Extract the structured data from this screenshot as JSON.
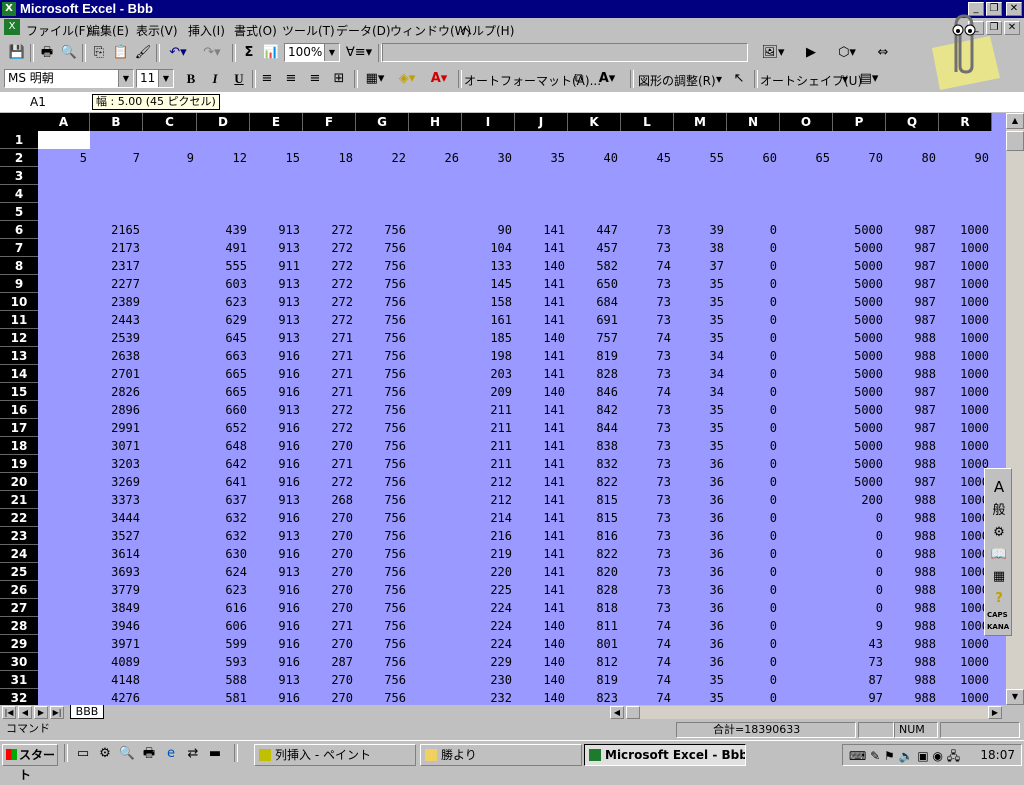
{
  "title_bar": {
    "title": "Microsoft Excel - Bbb"
  },
  "menu": [
    "ファイル(F)",
    "編集(E)",
    "表示(V)",
    "挿入(I)",
    "書式(O)",
    "ツール(T)",
    "データ(D)",
    "ウィンドウ(W)",
    "ヘルプ(H)"
  ],
  "toolbar": {
    "zoom": "100%",
    "sum_symbol": "Σ"
  },
  "format_toolbar": {
    "font": "MS 明朝",
    "size": "11",
    "bold": "B",
    "italic": "I",
    "underline": "U",
    "autoformat": "オートフォーマット(A)...",
    "draw_adjust": "図形の調整(R)",
    "autoshape": "オートシェイプ(U)"
  },
  "formula_bar": {
    "name_box": "A1",
    "tooltip": "幅 : 5.00 (45 ピクセル)"
  },
  "columns": [
    "A",
    "B",
    "C",
    "D",
    "E",
    "F",
    "G",
    "H",
    "I",
    "J",
    "K",
    "L",
    "M",
    "N",
    "O",
    "P",
    "Q",
    "R"
  ],
  "rows": [
    {
      "n": "1",
      "v": [
        "",
        "",
        "",
        "",
        "",
        "",
        "",
        "",
        "",
        "",
        "",
        "",
        "",
        "",
        "",
        "",
        "",
        ""
      ]
    },
    {
      "n": "2",
      "v": [
        "5",
        "7",
        "9",
        "12",
        "15",
        "18",
        "22",
        "26",
        "30",
        "35",
        "40",
        "45",
        "55",
        "60",
        "65",
        "70",
        "80",
        "90"
      ]
    },
    {
      "n": "3",
      "v": [
        "",
        "",
        "",
        "",
        "",
        "",
        "",
        "",
        "",
        "",
        "",
        "",
        "",
        "",
        "",
        "",
        "",
        ""
      ]
    },
    {
      "n": "4",
      "v": [
        "",
        "",
        "",
        "",
        "",
        "",
        "",
        "",
        "",
        "",
        "",
        "",
        "",
        "",
        "",
        "",
        "",
        ""
      ]
    },
    {
      "n": "5",
      "v": [
        "",
        "",
        "",
        "",
        "",
        "",
        "",
        "",
        "",
        "",
        "",
        "",
        "",
        "",
        "",
        "",
        "",
        ""
      ]
    },
    {
      "n": "6",
      "v": [
        "",
        "2165",
        "",
        "439",
        "913",
        "272",
        "756",
        "",
        "90",
        "141",
        "447",
        "73",
        "39",
        "0",
        "",
        "5000",
        "987",
        "1000"
      ]
    },
    {
      "n": "7",
      "v": [
        "",
        "2173",
        "",
        "491",
        "913",
        "272",
        "756",
        "",
        "104",
        "141",
        "457",
        "73",
        "38",
        "0",
        "",
        "5000",
        "987",
        "1000"
      ]
    },
    {
      "n": "8",
      "v": [
        "",
        "2317",
        "",
        "555",
        "911",
        "272",
        "756",
        "",
        "133",
        "140",
        "582",
        "74",
        "37",
        "0",
        "",
        "5000",
        "987",
        "1000"
      ]
    },
    {
      "n": "9",
      "v": [
        "",
        "2277",
        "",
        "603",
        "913",
        "272",
        "756",
        "",
        "145",
        "141",
        "650",
        "73",
        "35",
        "0",
        "",
        "5000",
        "987",
        "1000"
      ]
    },
    {
      "n": "10",
      "v": [
        "",
        "2389",
        "",
        "623",
        "913",
        "272",
        "756",
        "",
        "158",
        "141",
        "684",
        "73",
        "35",
        "0",
        "",
        "5000",
        "987",
        "1000"
      ]
    },
    {
      "n": "11",
      "v": [
        "",
        "2443",
        "",
        "629",
        "913",
        "272",
        "756",
        "",
        "161",
        "141",
        "691",
        "73",
        "35",
        "0",
        "",
        "5000",
        "987",
        "1000"
      ]
    },
    {
      "n": "12",
      "v": [
        "",
        "2539",
        "",
        "645",
        "913",
        "271",
        "756",
        "",
        "185",
        "140",
        "757",
        "74",
        "35",
        "0",
        "",
        "5000",
        "988",
        "1000"
      ]
    },
    {
      "n": "13",
      "v": [
        "",
        "2638",
        "",
        "663",
        "916",
        "271",
        "756",
        "",
        "198",
        "141",
        "819",
        "73",
        "34",
        "0",
        "",
        "5000",
        "988",
        "1000"
      ]
    },
    {
      "n": "14",
      "v": [
        "",
        "2701",
        "",
        "665",
        "916",
        "271",
        "756",
        "",
        "203",
        "141",
        "828",
        "73",
        "34",
        "0",
        "",
        "5000",
        "988",
        "1000"
      ]
    },
    {
      "n": "15",
      "v": [
        "",
        "2826",
        "",
        "665",
        "916",
        "271",
        "756",
        "",
        "209",
        "140",
        "846",
        "74",
        "34",
        "0",
        "",
        "5000",
        "987",
        "1000"
      ]
    },
    {
      "n": "16",
      "v": [
        "",
        "2896",
        "",
        "660",
        "913",
        "272",
        "756",
        "",
        "211",
        "141",
        "842",
        "73",
        "35",
        "0",
        "",
        "5000",
        "987",
        "1000"
      ]
    },
    {
      "n": "17",
      "v": [
        "",
        "2991",
        "",
        "652",
        "916",
        "272",
        "756",
        "",
        "211",
        "141",
        "844",
        "73",
        "35",
        "0",
        "",
        "5000",
        "987",
        "1000"
      ]
    },
    {
      "n": "18",
      "v": [
        "",
        "3071",
        "",
        "648",
        "916",
        "270",
        "756",
        "",
        "211",
        "141",
        "838",
        "73",
        "35",
        "0",
        "",
        "5000",
        "988",
        "1000"
      ]
    },
    {
      "n": "19",
      "v": [
        "",
        "3203",
        "",
        "642",
        "916",
        "271",
        "756",
        "",
        "211",
        "141",
        "832",
        "73",
        "36",
        "0",
        "",
        "5000",
        "988",
        "1000"
      ]
    },
    {
      "n": "20",
      "v": [
        "",
        "3269",
        "",
        "641",
        "916",
        "272",
        "756",
        "",
        "212",
        "141",
        "822",
        "73",
        "36",
        "0",
        "",
        "5000",
        "987",
        "1000"
      ]
    },
    {
      "n": "21",
      "v": [
        "",
        "3373",
        "",
        "637",
        "913",
        "268",
        "756",
        "",
        "212",
        "141",
        "815",
        "73",
        "36",
        "0",
        "",
        "200",
        "988",
        "1000"
      ]
    },
    {
      "n": "22",
      "v": [
        "",
        "3444",
        "",
        "632",
        "916",
        "270",
        "756",
        "",
        "214",
        "141",
        "815",
        "73",
        "36",
        "0",
        "",
        "0",
        "988",
        "1000"
      ]
    },
    {
      "n": "23",
      "v": [
        "",
        "3527",
        "",
        "632",
        "913",
        "270",
        "756",
        "",
        "216",
        "141",
        "816",
        "73",
        "36",
        "0",
        "",
        "0",
        "988",
        "1000"
      ]
    },
    {
      "n": "24",
      "v": [
        "",
        "3614",
        "",
        "630",
        "916",
        "270",
        "756",
        "",
        "219",
        "141",
        "822",
        "73",
        "36",
        "0",
        "",
        "0",
        "988",
        "1000"
      ]
    },
    {
      "n": "25",
      "v": [
        "",
        "3693",
        "",
        "624",
        "913",
        "270",
        "756",
        "",
        "220",
        "141",
        "820",
        "73",
        "36",
        "0",
        "",
        "0",
        "988",
        "1000"
      ]
    },
    {
      "n": "26",
      "v": [
        "",
        "3779",
        "",
        "623",
        "916",
        "270",
        "756",
        "",
        "225",
        "141",
        "828",
        "73",
        "36",
        "0",
        "",
        "0",
        "988",
        "1000"
      ]
    },
    {
      "n": "27",
      "v": [
        "",
        "3849",
        "",
        "616",
        "916",
        "270",
        "756",
        "",
        "224",
        "141",
        "818",
        "73",
        "36",
        "0",
        "",
        "0",
        "988",
        "1000"
      ]
    },
    {
      "n": "28",
      "v": [
        "",
        "3946",
        "",
        "606",
        "916",
        "271",
        "756",
        "",
        "224",
        "140",
        "811",
        "74",
        "36",
        "0",
        "",
        "9",
        "988",
        "1000"
      ]
    },
    {
      "n": "29",
      "v": [
        "",
        "3971",
        "",
        "599",
        "916",
        "270",
        "756",
        "",
        "224",
        "140",
        "801",
        "74",
        "36",
        "0",
        "",
        "43",
        "988",
        "1000"
      ]
    },
    {
      "n": "30",
      "v": [
        "",
        "4089",
        "",
        "593",
        "916",
        "287",
        "756",
        "",
        "229",
        "140",
        "812",
        "74",
        "36",
        "0",
        "",
        "73",
        "988",
        "1000"
      ]
    },
    {
      "n": "31",
      "v": [
        "",
        "4148",
        "",
        "588",
        "913",
        "270",
        "756",
        "",
        "230",
        "140",
        "819",
        "74",
        "35",
        "0",
        "",
        "87",
        "988",
        "1000"
      ]
    },
    {
      "n": "32",
      "v": [
        "",
        "4276",
        "",
        "581",
        "916",
        "270",
        "756",
        "",
        "232",
        "140",
        "823",
        "74",
        "35",
        "0",
        "",
        "97",
        "988",
        "1000"
      ]
    }
  ],
  "sheet_tab": "BBB",
  "status": {
    "mode": "コマンド",
    "sum": "合計=18390633",
    "num": "NUM"
  },
  "taskbar": {
    "start": "スタート",
    "tasks": [
      "列挿入 - ペイント",
      "勝より",
      "Microsoft Excel - Bbb"
    ],
    "clock": "18:07"
  },
  "floating_toolbar": {
    "kana": "KANA",
    "caps": "CAPS",
    "general": "般"
  },
  "colors": {
    "grid_bg": "#9999ff",
    "title_bg": "#000080",
    "header_bg": "#000000"
  }
}
